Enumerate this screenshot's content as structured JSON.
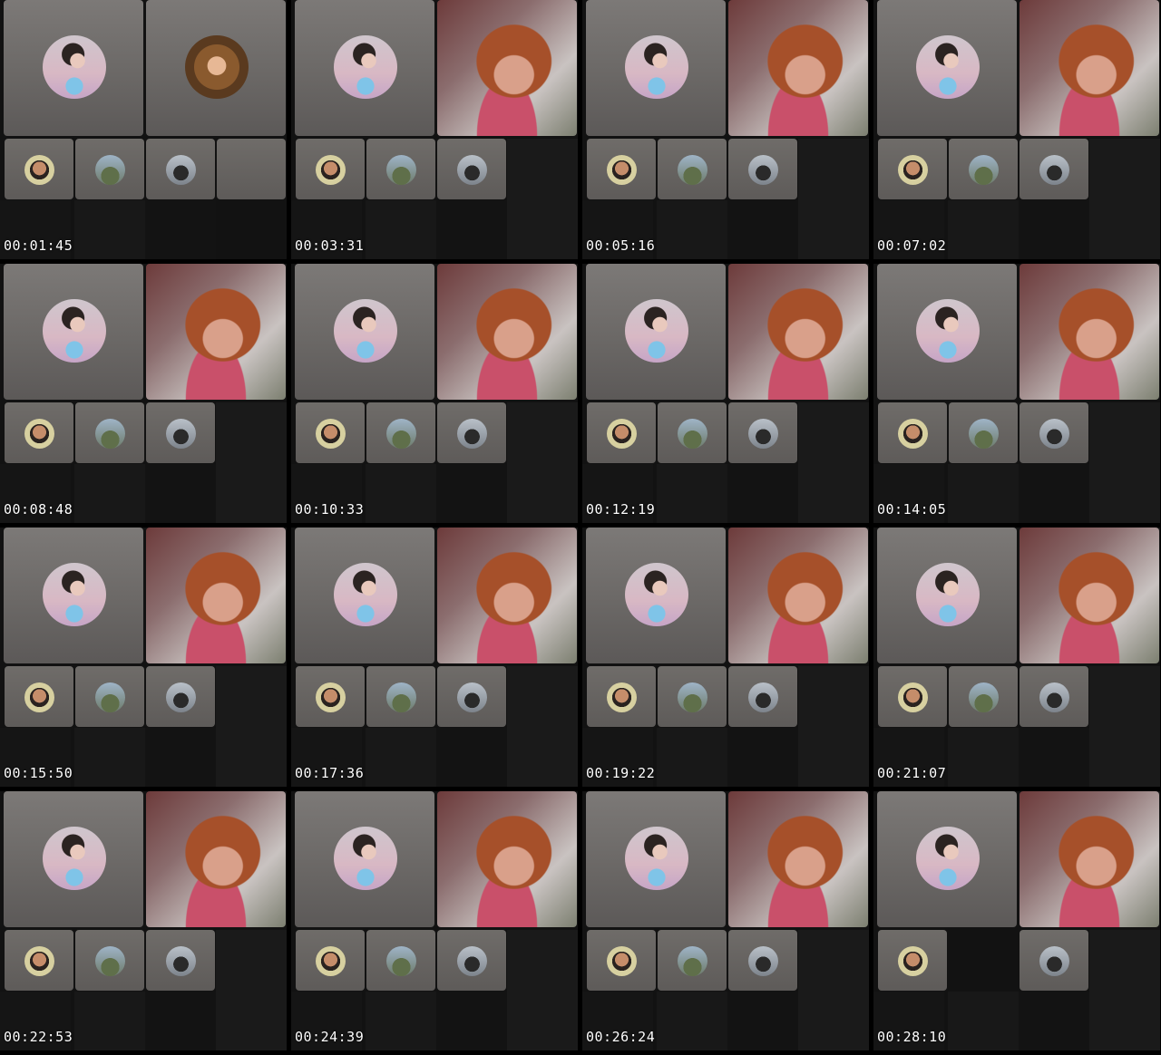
{
  "contact_sheet": {
    "timestamps": [
      "00:01:45",
      "00:03:31",
      "00:05:16",
      "00:07:02",
      "00:08:48",
      "00:10:33",
      "00:12:19",
      "00:14:05",
      "00:15:50",
      "00:17:36",
      "00:19:22",
      "00:21:07",
      "00:22:53",
      "00:24:39",
      "00:26:24",
      "00:28:10"
    ]
  }
}
